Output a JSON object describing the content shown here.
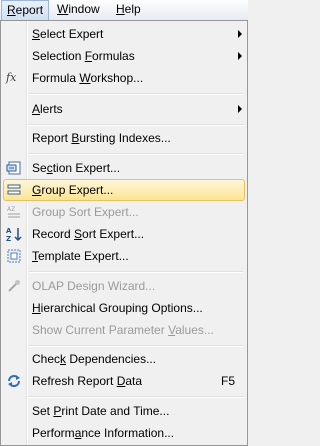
{
  "menubar": {
    "items": [
      {
        "label": "Report",
        "accel": "R",
        "rest": "eport"
      },
      {
        "label": "Window",
        "accel": "W",
        "rest": "indow"
      },
      {
        "label": "Help",
        "accel": "H",
        "rest": "elp"
      }
    ]
  },
  "menu": {
    "items": [
      {
        "pre": "",
        "accel": "S",
        "post": "elect Expert"
      },
      {
        "pre": "Selection ",
        "accel": "F",
        "post": "ormulas"
      },
      {
        "pre": "Formula ",
        "accel": "W",
        "post": "orkshop..."
      },
      {
        "pre": "",
        "accel": "A",
        "post": "lerts"
      },
      {
        "pre": "Report ",
        "accel": "B",
        "post": "ursting Indexes..."
      },
      {
        "pre": "Se",
        "accel": "c",
        "post": "tion Expert..."
      },
      {
        "pre": "",
        "accel": "G",
        "post": "roup Expert..."
      },
      {
        "pre": "Group Sort Expert...",
        "accel": "",
        "post": ""
      },
      {
        "pre": "Record ",
        "accel": "S",
        "post": "ort Expert..."
      },
      {
        "pre": "",
        "accel": "T",
        "post": "emplate Expert..."
      },
      {
        "pre": "OLAP Design Wizard...",
        "accel": "",
        "post": ""
      },
      {
        "pre": "",
        "accel": "H",
        "post": "ierarchical Grouping Options..."
      },
      {
        "pre": "Show Current Parameter ",
        "accel": "V",
        "post": "alues..."
      },
      {
        "pre": "Chec",
        "accel": "k",
        "post": " Dependencies..."
      },
      {
        "pre": "Refresh Report ",
        "accel": "D",
        "post": "ata"
      },
      {
        "pre": "Set ",
        "accel": "P",
        "post": "rint Date and Time..."
      },
      {
        "pre": "Perform",
        "accel": "a",
        "post": "nce Information..."
      }
    ],
    "refresh_shortcut": "F5",
    "formula_icon_text": "fx"
  }
}
